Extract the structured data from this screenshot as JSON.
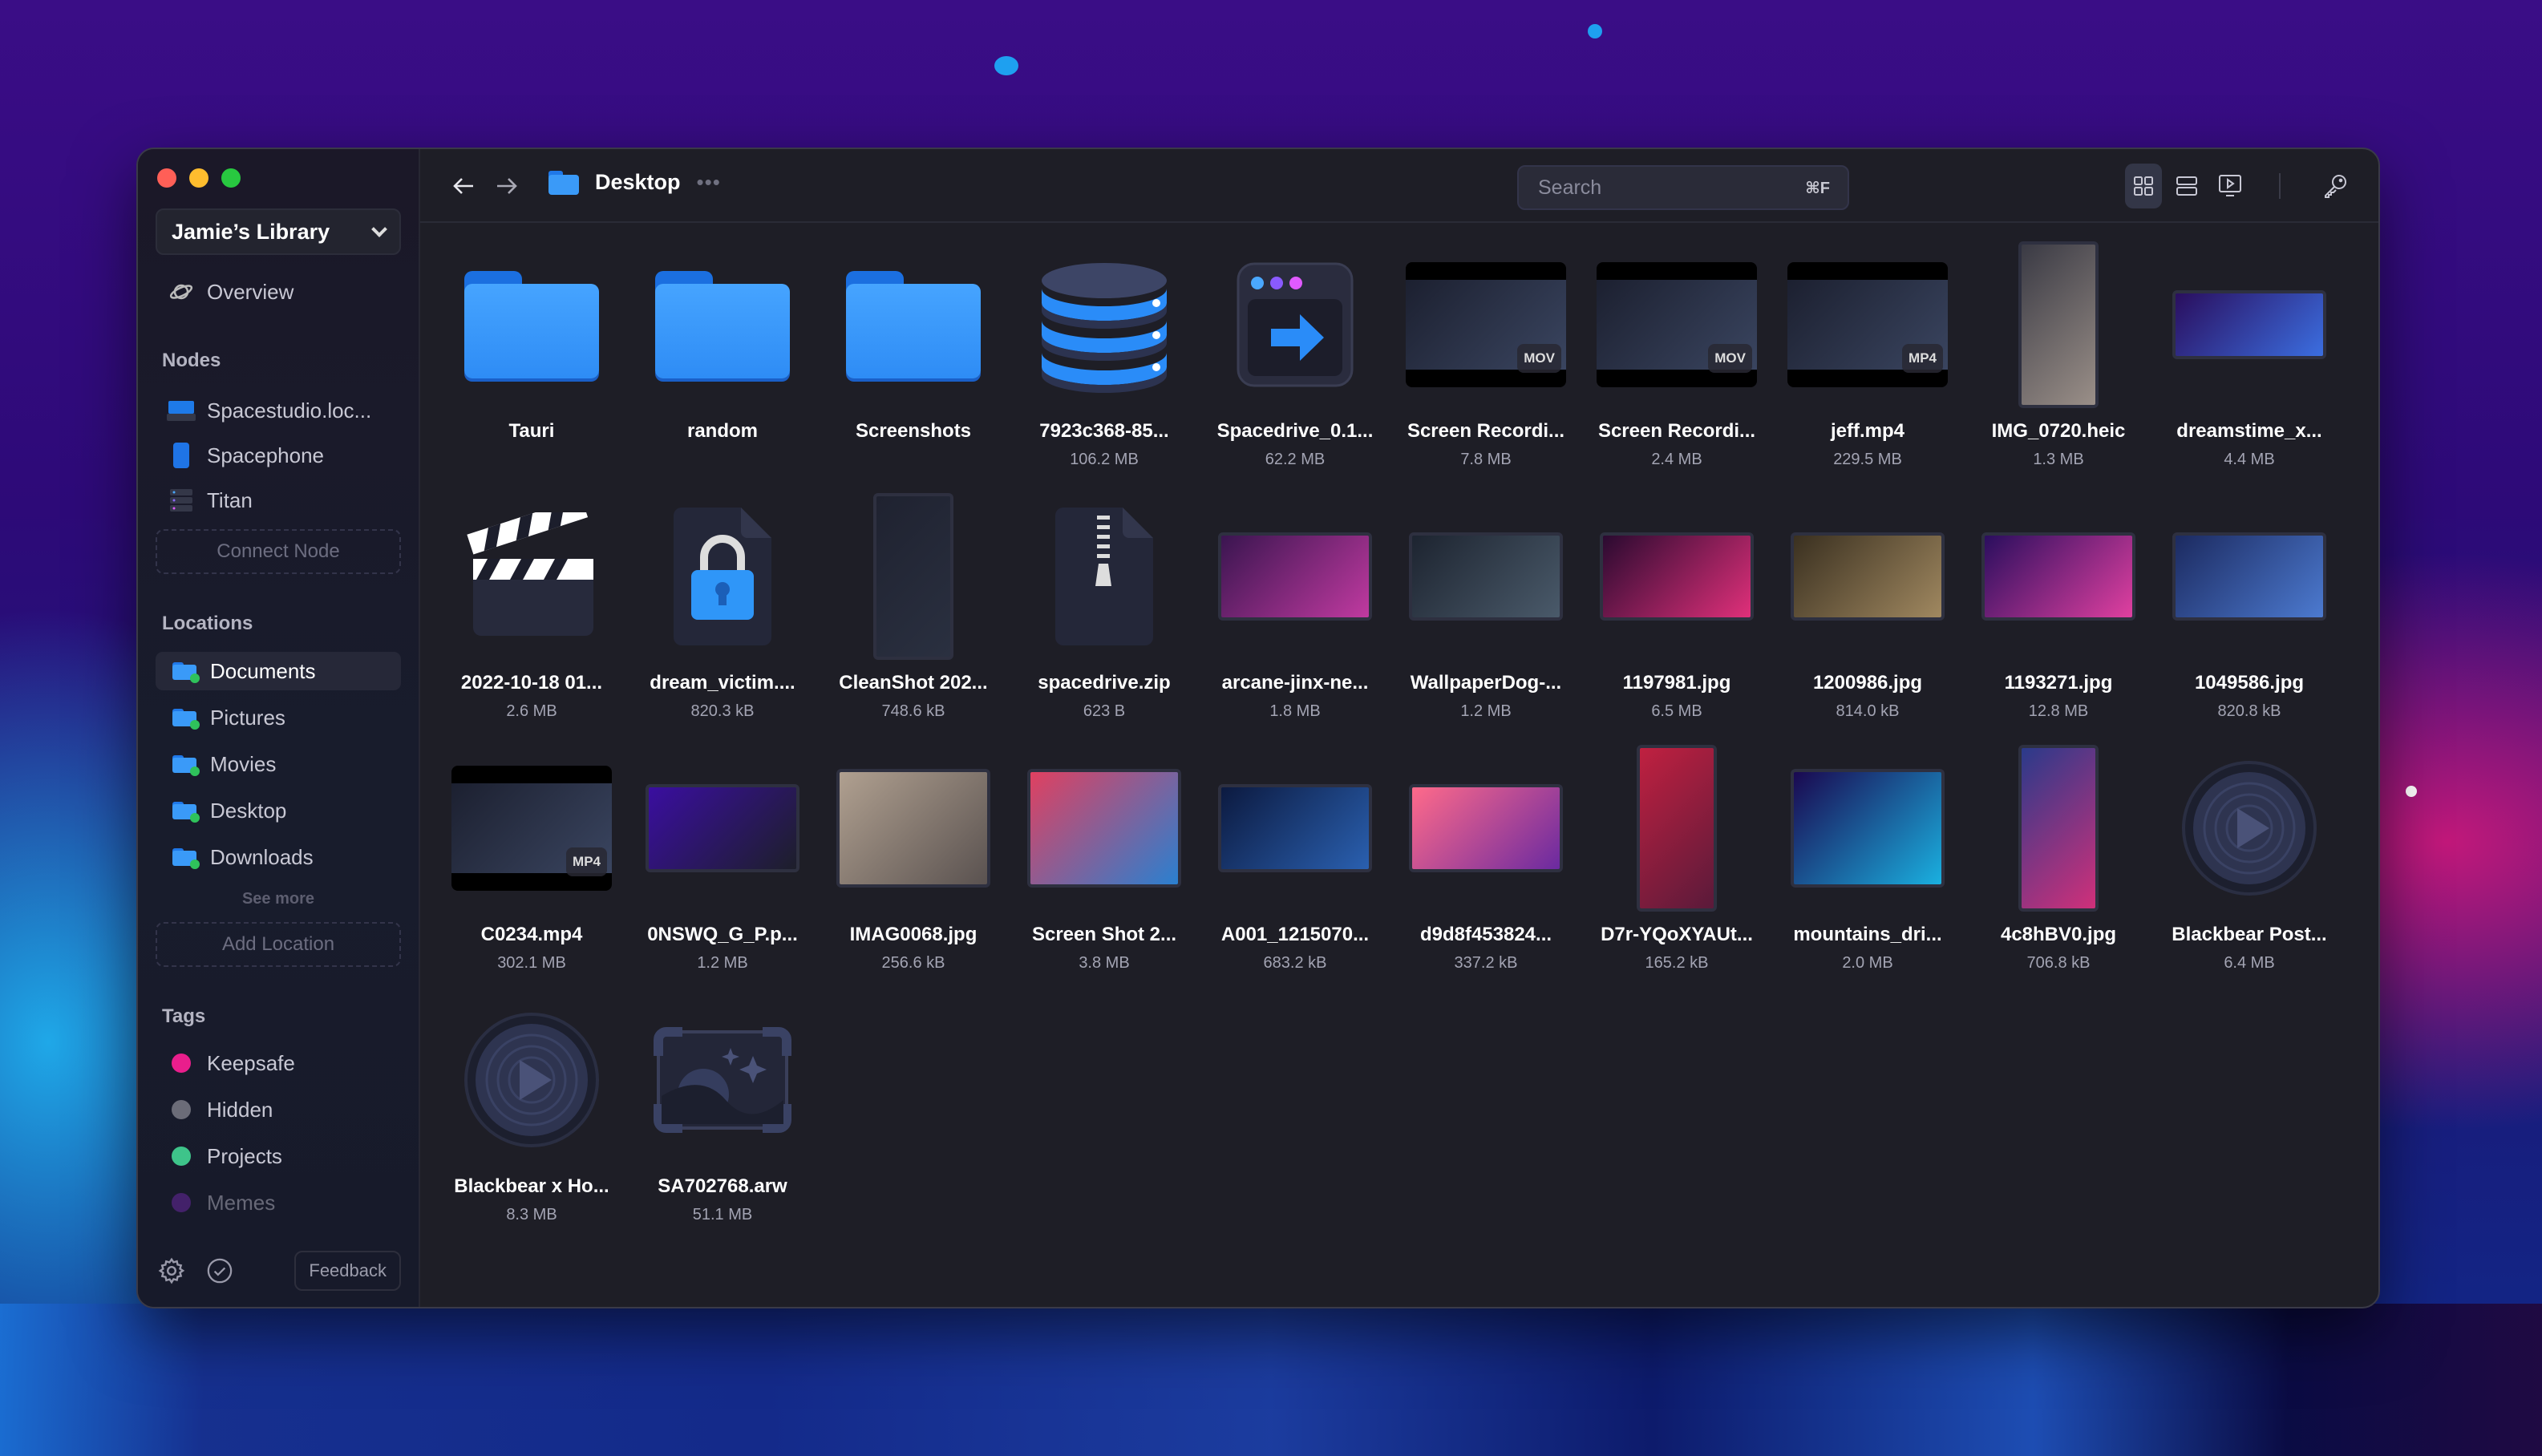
{
  "window": {
    "traffic_lights": {
      "close": "#ff5f57",
      "minimize": "#febc2e",
      "maximize": "#28c840"
    }
  },
  "sidebar": {
    "library": {
      "label": "Jamie’s Library",
      "icon": "chevron-down-icon"
    },
    "overview": {
      "label": "Overview",
      "icon": "planet-icon"
    },
    "nodes": {
      "title": "Nodes",
      "items": [
        {
          "label": "Spacestudio.loc...",
          "icon": "laptop-icon"
        },
        {
          "label": "Spacephone",
          "icon": "phone-icon"
        },
        {
          "label": "Titan",
          "icon": "server-icon"
        }
      ],
      "connect_label": "Connect Node"
    },
    "locations": {
      "title": "Locations",
      "items": [
        {
          "label": "Documents",
          "active": true,
          "status_color": "#2fc25b"
        },
        {
          "label": "Pictures",
          "active": false,
          "status_color": "#2fc25b"
        },
        {
          "label": "Movies",
          "active": false,
          "status_color": "#2fc25b"
        },
        {
          "label": "Desktop",
          "active": false,
          "status_color": "#2fc25b"
        },
        {
          "label": "Downloads",
          "active": false,
          "status_color": "#2fc25b"
        }
      ],
      "see_more": "See more",
      "add_label": "Add Location"
    },
    "tags": {
      "title": "Tags",
      "items": [
        {
          "label": "Keepsafe",
          "color": "#e91e8c"
        },
        {
          "label": "Hidden",
          "color": "#6b6c78"
        },
        {
          "label": "Projects",
          "color": "#3ec48a"
        },
        {
          "label": "Memes",
          "color": "#5a1f8a"
        }
      ]
    },
    "footer": {
      "settings_icon": "gear-icon",
      "jobs_icon": "check-circle-icon",
      "feedback_label": "Feedback"
    }
  },
  "toolbar": {
    "back_icon": "arrow-left-icon",
    "forward_icon": "arrow-right-icon",
    "current_folder": "Desktop",
    "more_icon": "ellipsis-icon",
    "search": {
      "placeholder": "Search",
      "value": "",
      "shortcut": "⌘F"
    },
    "views": [
      {
        "name": "grid-view",
        "active": true
      },
      {
        "name": "list-view",
        "active": false
      },
      {
        "name": "media-view",
        "active": false
      }
    ],
    "actions": [
      "key-icon",
      "tag-icon",
      "refresh-icon"
    ],
    "right": [
      "sliders-icon",
      "sidebar-toggle-icon"
    ]
  },
  "files": [
    {
      "name": "Tauri",
      "size": "",
      "kind": "folder"
    },
    {
      "name": "random",
      "size": "",
      "kind": "folder"
    },
    {
      "name": "Screenshots",
      "size": "",
      "kind": "folder"
    },
    {
      "name": "7923c368-85...",
      "size": "106.2 MB",
      "kind": "database"
    },
    {
      "name": "Spacedrive_0.1...",
      "size": "62.2 MB",
      "kind": "app"
    },
    {
      "name": "Screen Recordi...",
      "size": "7.8 MB",
      "kind": "video",
      "badge": "MOV"
    },
    {
      "name": "Screen Recordi...",
      "size": "2.4 MB",
      "kind": "video",
      "badge": "MOV"
    },
    {
      "name": "jeff.mp4",
      "size": "229.5 MB",
      "kind": "video",
      "badge": "MP4"
    },
    {
      "name": "IMG_0720.heic",
      "size": "1.3 MB",
      "kind": "image-portrait"
    },
    {
      "name": "dreamstime_x...",
      "size": "4.4 MB",
      "kind": "image-wide"
    },
    {
      "name": "2022-10-18 01...",
      "size": "2.6 MB",
      "kind": "clapper"
    },
    {
      "name": "dream_victim....",
      "size": "820.3 kB",
      "kind": "locked"
    },
    {
      "name": "CleanShot 202...",
      "size": "748.6 kB",
      "kind": "image-portrait"
    },
    {
      "name": "spacedrive.zip",
      "size": "623 B",
      "kind": "zip"
    },
    {
      "name": "arcane-jinx-ne...",
      "size": "1.8 MB",
      "kind": "image-landscape"
    },
    {
      "name": "WallpaperDog-...",
      "size": "1.2 MB",
      "kind": "image-landscape"
    },
    {
      "name": "1197981.jpg",
      "size": "6.5 MB",
      "kind": "image-landscape"
    },
    {
      "name": "1200986.jpg",
      "size": "814.0 kB",
      "kind": "image-landscape"
    },
    {
      "name": "1193271.jpg",
      "size": "12.8 MB",
      "kind": "image-landscape"
    },
    {
      "name": "1049586.jpg",
      "size": "820.8 kB",
      "kind": "image-landscape"
    },
    {
      "name": "C0234.mp4",
      "size": "302.1 MB",
      "kind": "video",
      "badge": "MP4"
    },
    {
      "name": "0NSWQ_G_P.p...",
      "size": "1.2 MB",
      "kind": "image-landscape"
    },
    {
      "name": "IMAG0068.jpg",
      "size": "256.6 kB",
      "kind": "image-square"
    },
    {
      "name": "Screen Shot 2...",
      "size": "3.8 MB",
      "kind": "image-square"
    },
    {
      "name": "A001_1215070...",
      "size": "683.2 kB",
      "kind": "image-landscape"
    },
    {
      "name": "d9d8f453824...",
      "size": "337.2 kB",
      "kind": "image-landscape"
    },
    {
      "name": "D7r-YQoXYAUt...",
      "size": "165.2 kB",
      "kind": "image-portrait"
    },
    {
      "name": "mountains_dri...",
      "size": "2.0 MB",
      "kind": "image-square"
    },
    {
      "name": "4c8hBV0.jpg",
      "size": "706.8 kB",
      "kind": "image-portrait"
    },
    {
      "name": "Blackbear Post...",
      "size": "6.4 MB",
      "kind": "audio"
    },
    {
      "name": "Blackbear x Ho...",
      "size": "8.3 MB",
      "kind": "audio"
    },
    {
      "name": "SA702768.arw",
      "size": "51.1 MB",
      "kind": "raw-image"
    }
  ],
  "thumb_colors": {
    "IMG_0720.heic": [
      "#3a3a44",
      "#9a8f88"
    ],
    "dreamstime_x...": [
      "#2a0e5e",
      "#3b6ee0"
    ],
    "CleanShot 202...": [
      "#1f2230",
      "#2a3040"
    ],
    "arcane-jinx-ne...": [
      "#3a1550",
      "#c03aa0"
    ],
    "WallpaperDog-...": [
      "#1d2430",
      "#4a5a6a"
    ],
    "1197981.jpg": [
      "#2a0a30",
      "#e0307a"
    ],
    "1200986.jpg": [
      "#3a3020",
      "#a08860"
    ],
    "1193271.jpg": [
      "#2a0e5e",
      "#e040a0"
    ],
    "1049586.jpg": [
      "#1c2a60",
      "#4c7ad0"
    ],
    "0NSWQ_G_P.p...": [
      "#3a0ea0",
      "#1d1f2a"
    ],
    "IMAG0068.jpg": [
      "#b0a090",
      "#5a5250"
    ],
    "Screen Shot 2...": [
      "#e04060",
      "#2a80d0"
    ],
    "A001_1215070...": [
      "#0c1a40",
      "#2a60b0"
    ],
    "d9d8f453824...": [
      "#ff6a8a",
      "#6a2aa0"
    ],
    "D7r-YQoXYAUt...": [
      "#c02040",
      "#5a1a3a"
    ],
    "mountains_dri...": [
      "#1a0850",
      "#1ab0e0"
    ],
    "4c8hBV0.jpg": [
      "#2a3a8a",
      "#d0307a"
    ]
  }
}
